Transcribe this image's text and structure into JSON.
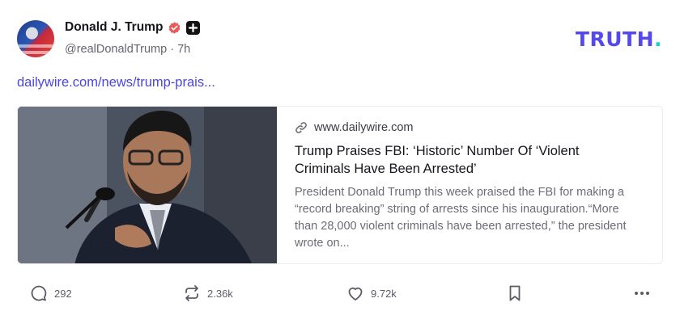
{
  "author": {
    "display_name": "Donald J. Trump",
    "handle": "@realDonaldTrump",
    "separator": "·",
    "time_ago": "7h"
  },
  "brand": {
    "logo_text": "TRUTH",
    "logo_dot": ".",
    "accent": "#5448ee",
    "dot_color": "#19d3c5"
  },
  "post": {
    "link_text": "dailywire.com/news/trump-prais..."
  },
  "link_card": {
    "domain": "www.dailywire.com",
    "title": "Trump Praises FBI: ‘Historic’ Number Of ‘Violent Criminals Have Been Arrested’",
    "description": "President Donald Trump this week praised the FBI for making a “record breaking” string of arrests since his inauguration.“More than 28,000 violent criminals have been arrested,” the president wrote on..."
  },
  "actions": {
    "replies": "292",
    "retruths": "2.36k",
    "likes": "9.72k"
  },
  "icons": [
    "verified-icon",
    "plus-icon",
    "link-icon",
    "reply-icon",
    "retruth-icon",
    "heart-icon",
    "bookmark-icon",
    "more-icon"
  ]
}
